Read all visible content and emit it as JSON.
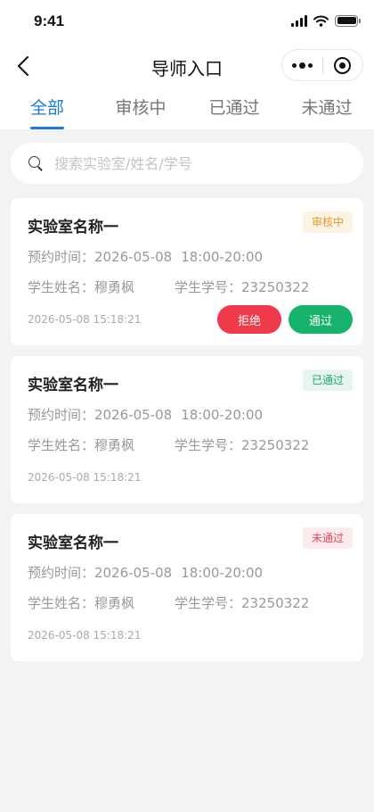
{
  "status_bar": {
    "time": "9:41"
  },
  "nav": {
    "title": "导师入口"
  },
  "tabs": [
    {
      "label": "全部",
      "active": true
    },
    {
      "label": "审核中",
      "active": false
    },
    {
      "label": "已通过",
      "active": false
    },
    {
      "label": "未通过",
      "active": false
    }
  ],
  "search": {
    "placeholder": "搜索实验室/姓名/学号",
    "value": ""
  },
  "colors": {
    "accent": "#1e78e4",
    "reject": "#ee3a4a",
    "approve": "#17b36d",
    "pending": "#e39a2f",
    "passed": "#1fa56b",
    "rejected": "#e0475a"
  },
  "cards": [
    {
      "lab_name": "实验室名称一",
      "status": "审核中",
      "time_label": "预约时间：",
      "date": "2026-05-08",
      "time_range": "18:00-20:00",
      "student_name_label": "学生姓名：",
      "student_name": "穆勇枫",
      "student_id_label": "学生学号：",
      "student_id": "23250322",
      "created_at": "2026-05-08  15:18:21",
      "reject_label": "拒绝",
      "approve_label": "通过"
    },
    {
      "lab_name": "实验室名称一",
      "status": "已通过",
      "time_label": "预约时间：",
      "date": "2026-05-08",
      "time_range": "18:00-20:00",
      "student_name_label": "学生姓名：",
      "student_name": "穆勇枫",
      "student_id_label": "学生学号：",
      "student_id": "23250322",
      "created_at": "2026-05-08  15:18:21"
    },
    {
      "lab_name": "实验室名称一",
      "status": "未通过",
      "time_label": "预约时间：",
      "date": "2026-05-08",
      "time_range": "18:00-20:00",
      "student_name_label": "学生姓名：",
      "student_name": "穆勇枫",
      "student_id_label": "学生学号：",
      "student_id": "23250322",
      "created_at": "2026-05-08  15:18:21"
    }
  ]
}
